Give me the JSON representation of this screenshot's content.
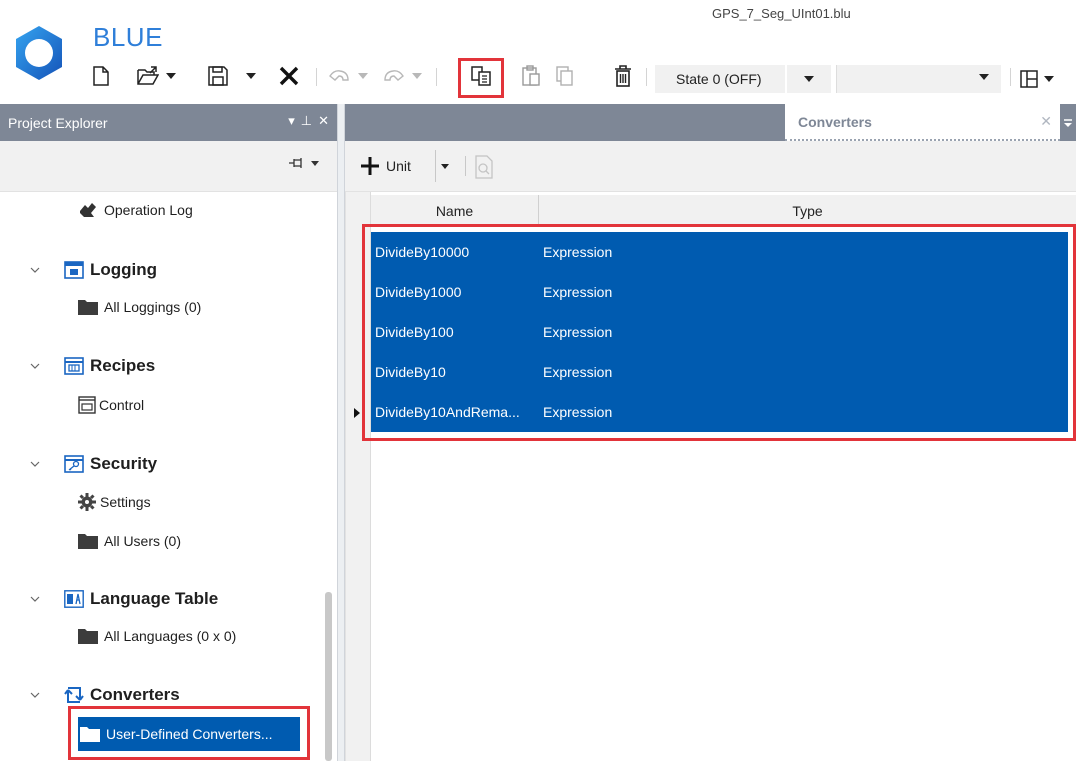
{
  "app": {
    "name": "BLUE",
    "window_title": "GPS_7_Seg_UInt01.blu"
  },
  "toolbar": {
    "state_value": "State 0 (OFF)"
  },
  "project_explorer": {
    "title": "Project Explorer",
    "controls": [
      "▾",
      "⊥",
      "✕"
    ],
    "tree": [
      {
        "label": "Operation Log",
        "kind": "item",
        "icon": "operation-log-icon"
      },
      {
        "label": "Logging",
        "kind": "category",
        "icon": "logging-icon"
      },
      {
        "label": "All Loggings (0)",
        "kind": "item",
        "icon": "folder-icon"
      },
      {
        "label": "Recipes",
        "kind": "category",
        "icon": "recipes-icon"
      },
      {
        "label": "Control",
        "kind": "item",
        "icon": "control-icon"
      },
      {
        "label": "Security",
        "kind": "category",
        "icon": "security-icon"
      },
      {
        "label": "Settings",
        "kind": "item",
        "icon": "gear-icon"
      },
      {
        "label": "All Users (0)",
        "kind": "item",
        "icon": "folder-icon"
      },
      {
        "label": "Language Table",
        "kind": "category",
        "icon": "language-icon"
      },
      {
        "label": "All Languages (0 x 0)",
        "kind": "item",
        "icon": "folder-icon"
      },
      {
        "label": "Converters",
        "kind": "category",
        "icon": "converters-icon"
      },
      {
        "label": "User-Defined Converters...",
        "kind": "selected-item",
        "icon": "folder-icon"
      }
    ]
  },
  "document": {
    "tab_label": "Converters",
    "unit_label": "Unit",
    "columns": [
      "Name",
      "Type"
    ],
    "rows": [
      {
        "name": "DivideBy10000",
        "type": "Expression"
      },
      {
        "name": "DivideBy1000",
        "type": "Expression"
      },
      {
        "name": "DivideBy100",
        "type": "Expression"
      },
      {
        "name": "DivideBy10",
        "type": "Expression"
      },
      {
        "name": "DivideBy10AndRema...",
        "type": "Expression"
      }
    ]
  },
  "colors": {
    "accent": "#2f7fd9",
    "selection": "#005bb0",
    "header_bar": "#7e8796",
    "highlight_box": "#e2343a"
  }
}
